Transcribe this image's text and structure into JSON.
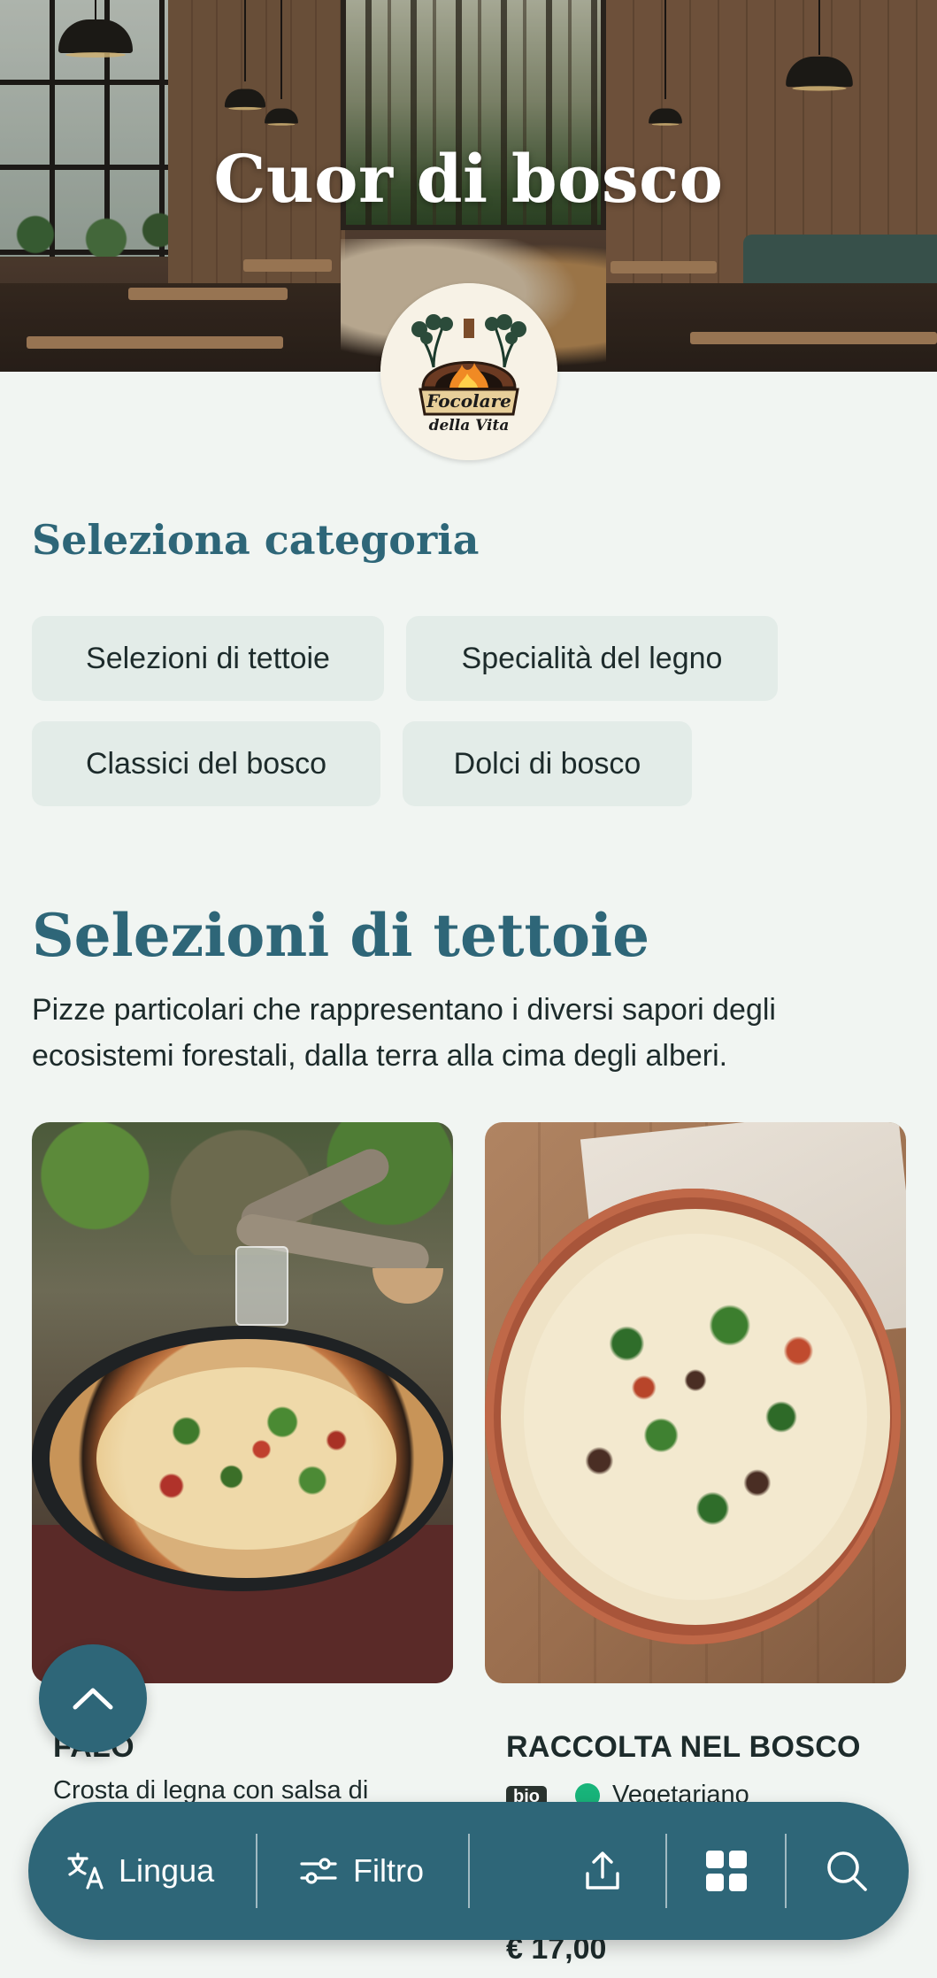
{
  "hero": {
    "title": "Cuor di bosco",
    "logo_text": [
      "Focolare",
      "della Vita"
    ]
  },
  "category_section": {
    "heading": "Seleziona categoria",
    "chips": [
      "Selezioni di tettoie",
      "Specialità del legno",
      "Classici del bosco",
      "Dolci di bosco"
    ]
  },
  "section": {
    "title": "Selezioni di tettoie",
    "description": "Pizze particolari che rappresentano i diversi sapori degli ecosistemi forestali, dalla terra alla cima degli alberi."
  },
  "products": [
    {
      "name": "FALÒ",
      "description": "Crosta di legna con salsa di",
      "image": "skillet-pizza-photo"
    },
    {
      "name": "RACCOLTA NEL BOSCO",
      "badge": "bio",
      "tag": "Vegetariano",
      "price": "€ 17,00",
      "image": "wild-greens-pizza-photo"
    }
  ],
  "bottom_bar": {
    "language_label": "Lingua",
    "filter_label": "Filtro",
    "icons": [
      "translate-icon",
      "filter-icon",
      "share-icon",
      "grid-icon",
      "search-icon"
    ]
  },
  "colors": {
    "primary": "#2e6678",
    "background": "#f1f5f2",
    "chip": "#e3ece8",
    "text": "#1d2b2b",
    "veg": "#18b47a"
  }
}
